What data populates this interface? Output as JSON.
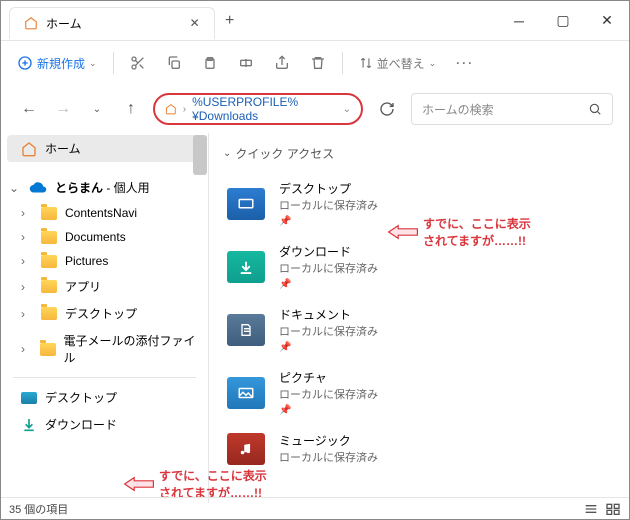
{
  "titlebar": {
    "tab_title": "ホーム"
  },
  "toolbar": {
    "new_label": "新規作成",
    "sort_label": "並べ替え"
  },
  "address": {
    "path": "%USERPROFILE%¥Downloads"
  },
  "search": {
    "placeholder": "ホームの検索"
  },
  "sidebar": {
    "home": "ホーム",
    "onedrive_user": "とらまん",
    "onedrive_suffix": " - 個人用",
    "items": [
      "ContentsNavi",
      "Documents",
      "Pictures",
      "アプリ",
      "デスクトップ",
      "電子メールの添付ファイル"
    ],
    "lower": {
      "desktop": "デスクトップ",
      "downloads": "ダウンロード"
    }
  },
  "content": {
    "section": "クイック アクセス",
    "items": [
      {
        "name": "デスクトップ",
        "sub": "ローカルに保存済み"
      },
      {
        "name": "ダウンロード",
        "sub": "ローカルに保存済み"
      },
      {
        "name": "ドキュメント",
        "sub": "ローカルに保存済み"
      },
      {
        "name": "ピクチャ",
        "sub": "ローカルに保存済み"
      },
      {
        "name": "ミュージック",
        "sub": "ローカルに保存済み"
      }
    ]
  },
  "annotation": {
    "line1": "すでに、ここに表示",
    "line2": "されてますが……!!"
  },
  "status": {
    "count": "35 個の項目"
  },
  "colors": {
    "accent": "#d9363e",
    "teal": "#0e9f8e",
    "blue": "#2d7dd2"
  }
}
